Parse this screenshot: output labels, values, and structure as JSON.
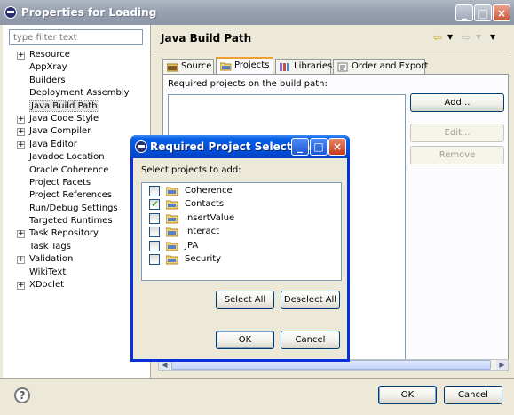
{
  "window": {
    "title": "Properties for Loading"
  },
  "filter": {
    "placeholder": "type filter text"
  },
  "tree": [
    {
      "label": "Resource",
      "expandable": true
    },
    {
      "label": "AppXray",
      "expandable": false
    },
    {
      "label": "Builders",
      "expandable": false
    },
    {
      "label": "Deployment Assembly",
      "expandable": false
    },
    {
      "label": "Java Build Path",
      "expandable": false,
      "selected": true
    },
    {
      "label": "Java Code Style",
      "expandable": true
    },
    {
      "label": "Java Compiler",
      "expandable": true
    },
    {
      "label": "Java Editor",
      "expandable": true
    },
    {
      "label": "Javadoc Location",
      "expandable": false
    },
    {
      "label": "Oracle Coherence",
      "expandable": false
    },
    {
      "label": "Project Facets",
      "expandable": false
    },
    {
      "label": "Project References",
      "expandable": false
    },
    {
      "label": "Run/Debug Settings",
      "expandable": false
    },
    {
      "label": "Targeted Runtimes",
      "expandable": false
    },
    {
      "label": "Task Repository",
      "expandable": true
    },
    {
      "label": "Task Tags",
      "expandable": false
    },
    {
      "label": "Validation",
      "expandable": true
    },
    {
      "label": "WikiText",
      "expandable": false
    },
    {
      "label": "XDoclet",
      "expandable": true
    }
  ],
  "main": {
    "title": "Java Build Path",
    "tabs": [
      {
        "label": "Source"
      },
      {
        "label": "Projects",
        "active": true
      },
      {
        "label": "Libraries"
      },
      {
        "label": "Order and Export"
      }
    ],
    "required_label": "Required projects on the build path:",
    "add_label": "Add...",
    "edit_label": "Edit...",
    "remove_label": "Remove"
  },
  "footer": {
    "ok_label": "OK",
    "cancel_label": "Cancel"
  },
  "dialog": {
    "title": "Required Project Selection",
    "prompt": "Select projects to add:",
    "projects": [
      {
        "name": "Coherence",
        "checked": false
      },
      {
        "name": "Contacts",
        "checked": true
      },
      {
        "name": "InsertValue",
        "checked": false
      },
      {
        "name": "Interact",
        "checked": false
      },
      {
        "name": "JPA",
        "checked": false
      },
      {
        "name": "Security",
        "checked": false
      }
    ],
    "select_all_label": "Select All",
    "deselect_all_label": "Deselect All",
    "ok_label": "OK",
    "cancel_label": "Cancel"
  },
  "colors": {
    "accent": "#0054e3",
    "tab_highlight": "#f0a030",
    "check": "#21a121"
  }
}
